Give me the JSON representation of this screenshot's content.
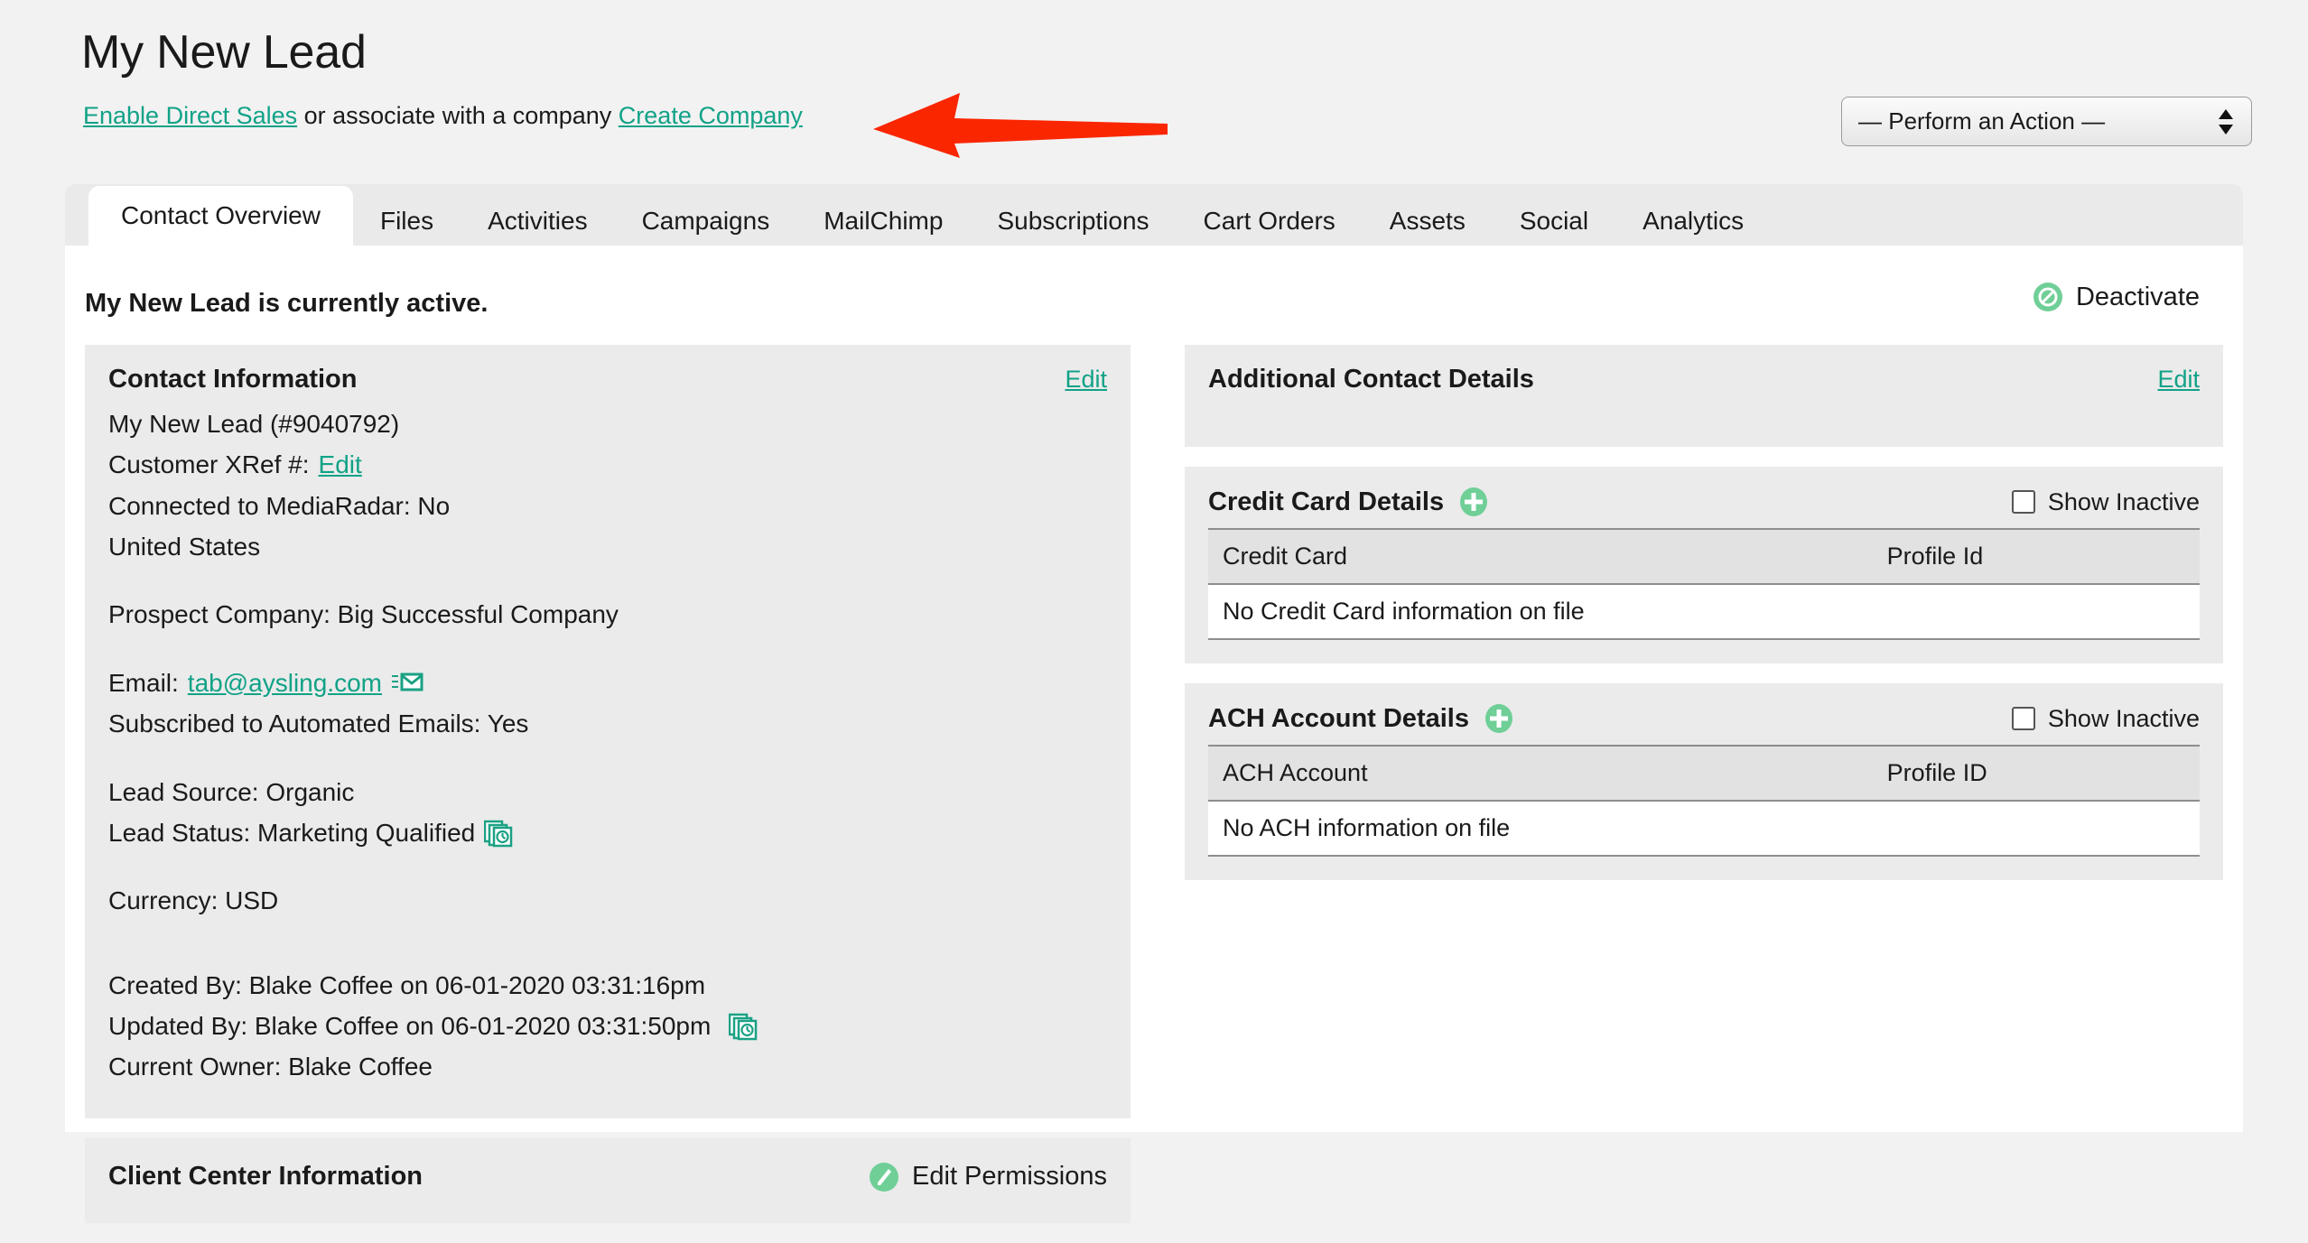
{
  "header": {
    "title": "My New Lead",
    "enable_direct_sales_link": "Enable Direct Sales",
    "middle_text": " or associate with a company ",
    "create_company_link": "Create Company",
    "action_select_value": "— Perform an Action —",
    "action_select_options": [
      "— Perform an Action —"
    ]
  },
  "tabs": [
    {
      "label": "Contact Overview",
      "active": true
    },
    {
      "label": "Files",
      "active": false
    },
    {
      "label": "Activities",
      "active": false
    },
    {
      "label": "Campaigns",
      "active": false
    },
    {
      "label": "MailChimp",
      "active": false
    },
    {
      "label": "Subscriptions",
      "active": false
    },
    {
      "label": "Cart Orders",
      "active": false
    },
    {
      "label": "Assets",
      "active": false
    },
    {
      "label": "Social",
      "active": false
    },
    {
      "label": "Analytics",
      "active": false
    }
  ],
  "status": {
    "text": "My New Lead is currently active.",
    "deactivate_label": "Deactivate"
  },
  "contact_information": {
    "title": "Contact Information",
    "edit_label": "Edit",
    "name_and_id": "My New Lead (#9040792)",
    "customer_xref_label": "Customer XRef #:",
    "customer_xref_edit": "Edit",
    "mediaradar": "Connected to MediaRadar: No",
    "country": "United States",
    "prospect_company": "Prospect Company: Big Successful Company",
    "email_label": "Email:",
    "email_value": "tab@aysling.com",
    "subscribed": "Subscribed to Automated Emails: Yes",
    "lead_source": "Lead Source: Organic",
    "lead_status": "Lead Status: Marketing Qualified",
    "currency": "Currency: USD",
    "created_by": "Created By: Blake Coffee on 06-01-2020 03:31:16pm",
    "updated_by": "Updated By: Blake Coffee on 06-01-2020 03:31:50pm",
    "current_owner": "Current Owner: Blake Coffee"
  },
  "client_center": {
    "title": "Client Center Information",
    "edit_permissions_label": "Edit Permissions"
  },
  "additional_contact_details": {
    "title": "Additional Contact Details",
    "edit_label": "Edit"
  },
  "credit_card_details": {
    "title": "Credit Card Details",
    "show_inactive_label": "Show Inactive",
    "columns": [
      "Credit Card",
      "Profile Id"
    ],
    "empty_message": "No Credit Card information on file"
  },
  "ach_account_details": {
    "title": "ACH Account Details",
    "show_inactive_label": "Show Inactive",
    "columns": [
      "ACH Account",
      "Profile ID"
    ],
    "empty_message": "No ACH information on file"
  },
  "icons": {
    "deactivate": "no-entry-icon",
    "email": "envelope-icon",
    "history": "history-stack-icon",
    "add": "plus-circle-icon",
    "edit_pencil": "pencil-circle-icon",
    "annotation": "red-left-arrow"
  },
  "colors": {
    "link": "#11a287",
    "accent_green": "#6fcf97",
    "annotation_red": "#fa2600",
    "panel_bg": "#ebebeb",
    "page_bg": "#f2f2f2"
  }
}
